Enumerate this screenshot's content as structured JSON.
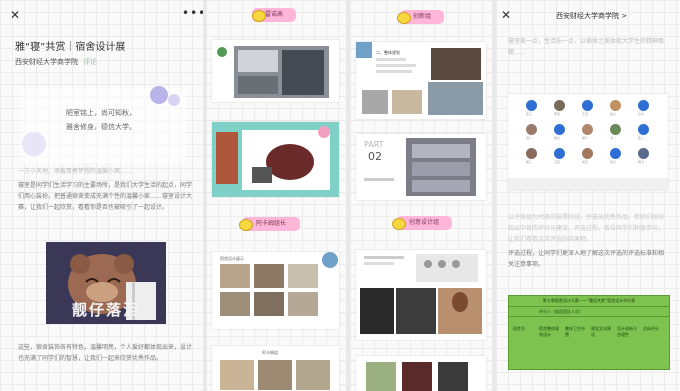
{
  "panel1": {
    "close_icon": "✕",
    "more_icon": "•••",
    "title": "雅“寝”共赏｜宿舍设计展",
    "account": "西安财经大学商学院",
    "tag": "评论",
    "quote_line1": "陋室铭上，尚可知秋，",
    "quote_line2": "雅舍修身，德信大学。",
    "faint_line": "一方小天地，承载青春梦想的温馨小窝……",
    "para1": "寝室是同学们生活学习的主要场所，是我们大学生活的起点，同学们用心装扮，把普通宿舍变成充满个性的温馨小家……寝室设计大赛，让我们一起欣赏，看看你是否也被吸引了一起设计。",
    "meme_caption": "靓仔落泪",
    "para2": "这些，宿舍装饰各有特色，温馨明亮，个人爱好都体现出来，设计也充满了同学们的智慧，让我们一起来欣赏优秀作品。"
  },
  "panel2": {
    "label_top": "雷诺高",
    "label_mid": "阿卡姆组长",
    "s4_title": "宿舍设计展示",
    "s5_title": "阿卡姆组"
  },
  "panel3": {
    "label_top": "创新组",
    "label_mid": "创意设计组",
    "s2_part": "PART",
    "s2_num": "02",
    "s1_title": "二、整体规划"
  },
  "panel4": {
    "close_icon": "✕",
    "header": "西安财经大学商学院 >",
    "faint1": "寝室美一点，生活乐一点，以宿舍之美体现大学生的精神面貌……",
    "faint2": "",
    "avatars": [
      "张三",
      "李四",
      "王五",
      "赵六",
      "孙七",
      "周八",
      "吴九",
      "郑十",
      "冯一",
      "陈二",
      "褚三",
      "卫四",
      "蒋五",
      "沈六",
      "韩七"
    ],
    "para": "以评审组为代表的投票阶段，评选出优秀作品，老师们纷纷给出中肯的评价与建议，评选过程，各位同学们积极参与，让我们看看这次评选的结果吧。",
    "para_dark": "评选过程，让同学们更深入地了解这次评选的评选标准和相关注意事项。",
    "table_title": "第七季宿舍设计大赛——“雅设共赏”宿舍设计评分表",
    "table_cells": [
      "评分人（组员团队人员）",
      "宿舍号",
      "宿舍整体规划设计",
      "整体卫生布置",
      "寝室文化建设",
      "设计创新与合理性",
      "总体评分"
    ]
  }
}
